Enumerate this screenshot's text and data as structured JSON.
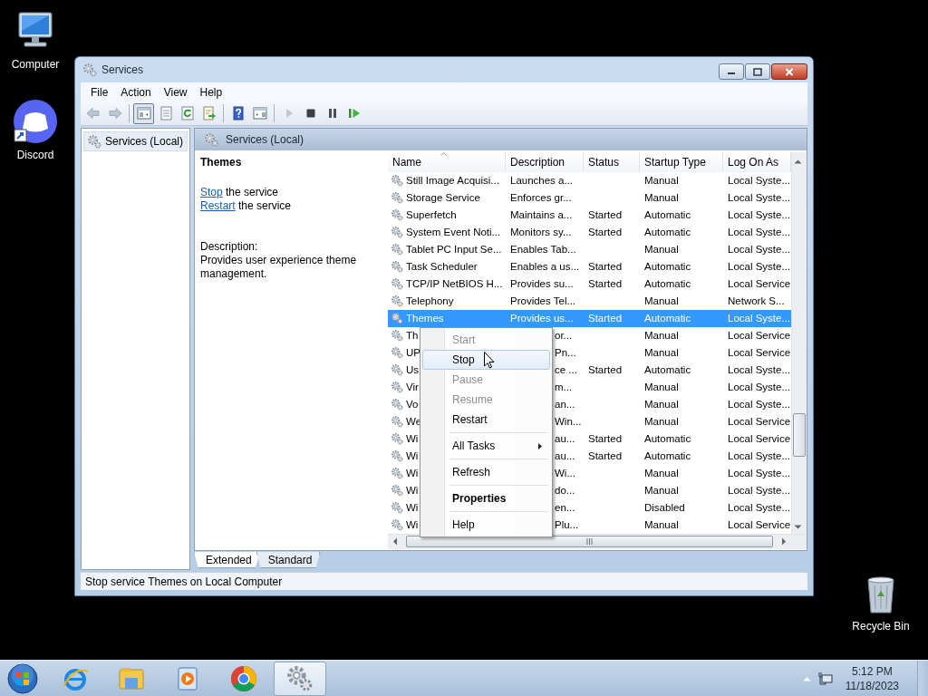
{
  "desktop_icons": [
    {
      "label": "Computer",
      "kind": "computer"
    },
    {
      "label": "Discord",
      "kind": "discord"
    },
    {
      "label": "Recycle Bin",
      "kind": "recycle"
    }
  ],
  "window": {
    "title": "Services",
    "menu": [
      "File",
      "Action",
      "View",
      "Help"
    ],
    "toolbar": [
      {
        "kind": "back",
        "disabled": true,
        "pressed": false
      },
      {
        "kind": "forward",
        "disabled": true,
        "pressed": false
      },
      {
        "kind": "separator"
      },
      {
        "kind": "console",
        "disabled": false,
        "pressed": true
      },
      {
        "kind": "properties",
        "disabled": false,
        "pressed": false
      },
      {
        "kind": "refresh",
        "disabled": false,
        "pressed": false
      },
      {
        "kind": "export",
        "disabled": false,
        "pressed": false
      },
      {
        "kind": "separator"
      },
      {
        "kind": "help",
        "disabled": false,
        "pressed": false
      },
      {
        "kind": "panel",
        "disabled": false,
        "pressed": false
      },
      {
        "kind": "separator"
      },
      {
        "kind": "start",
        "disabled": true,
        "pressed": false
      },
      {
        "kind": "stop",
        "disabled": false,
        "pressed": false
      },
      {
        "kind": "pause",
        "disabled": false,
        "pressed": false
      },
      {
        "kind": "resume",
        "disabled": false,
        "pressed": false
      }
    ],
    "tree": [
      {
        "label": "Services (Local)",
        "selected": true
      }
    ],
    "header": "Services (Local)",
    "details": {
      "title": "Themes",
      "actions": [
        {
          "link": "Stop",
          "text": " the service"
        },
        {
          "link": "Restart",
          "text": " the service"
        }
      ],
      "description_label": "Description:",
      "description": "Provides user experience theme management."
    },
    "table": {
      "columns": [
        {
          "label": "Name",
          "sorted": true
        },
        {
          "label": "Description",
          "sorted": false
        },
        {
          "label": "Status",
          "sorted": false
        },
        {
          "label": "Startup Type",
          "sorted": false
        },
        {
          "label": "Log On As",
          "sorted": false
        }
      ],
      "rows": [
        {
          "kind": "full",
          "name": "Still Image Acquisi...",
          "description": "Launches a...",
          "startup": "Manual",
          "logon": "Local Syste...",
          "selected": false
        },
        {
          "kind": "full",
          "name": "Storage Service",
          "description": "Enforces gr...",
          "startup": "Manual",
          "logon": "Local Syste...",
          "selected": false
        },
        {
          "kind": "full",
          "name": "Superfetch",
          "description": "Maintains a...",
          "status": "Started",
          "startup": "Automatic",
          "logon": "Local Syste...",
          "selected": false
        },
        {
          "kind": "full",
          "name": "System Event Noti...",
          "description": "Monitors sy...",
          "status": "Started",
          "startup": "Automatic",
          "logon": "Local Syste...",
          "selected": false
        },
        {
          "kind": "full",
          "name": "Tablet PC Input Se...",
          "description": "Enables Tab...",
          "startup": "Manual",
          "logon": "Local Syste...",
          "selected": false
        },
        {
          "kind": "full",
          "name": "Task Scheduler",
          "description": "Enables a us...",
          "status": "Started",
          "startup": "Automatic",
          "logon": "Local Syste...",
          "selected": false
        },
        {
          "kind": "full",
          "name": "TCP/IP NetBIOS H...",
          "description": "Provides su...",
          "status": "Started",
          "startup": "Automatic",
          "logon": "Local Service",
          "selected": false
        },
        {
          "kind": "full",
          "name": "Telephony",
          "description": "Provides Tel...",
          "startup": "Manual",
          "logon": "Network S...",
          "selected": false
        },
        {
          "kind": "full",
          "name": "Themes",
          "description": "Provides us...",
          "status": "Started",
          "startup": "Automatic",
          "logon": "Local Syste...",
          "selected": true
        },
        {
          "kind": "under_menu",
          "name": "Th",
          "description": "or...",
          "startup": "Manual",
          "logon": "Local Service",
          "selected": false
        },
        {
          "kind": "under_menu",
          "name": "UP",
          "description": "Pn...",
          "startup": "Manual",
          "logon": "Local Service",
          "selected": false
        },
        {
          "kind": "under_menu",
          "name": "Us",
          "description": "ce ...",
          "status": "Started",
          "startup": "Automatic",
          "logon": "Local Syste...",
          "selected": false
        },
        {
          "kind": "under_menu",
          "name": "Vir",
          "description": "m...",
          "startup": "Manual",
          "logon": "Local Syste...",
          "selected": false
        },
        {
          "kind": "under_menu",
          "name": "Vo",
          "description": "an...",
          "startup": "Manual",
          "logon": "Local Syste...",
          "selected": false
        },
        {
          "kind": "under_menu",
          "name": "We",
          "description": "Win...",
          "startup": "Manual",
          "logon": "Local Service",
          "selected": false
        },
        {
          "kind": "under_menu",
          "name": "Wi",
          "description": "au...",
          "status": "Started",
          "startup": "Automatic",
          "logon": "Local Service",
          "selected": false
        },
        {
          "kind": "under_menu",
          "name": "Wi",
          "description": "au...",
          "status": "Started",
          "startup": "Automatic",
          "logon": "Local Syste...",
          "selected": false
        },
        {
          "kind": "under_menu",
          "name": "Wi",
          "description": "Wi...",
          "startup": "Manual",
          "logon": "Local Syste...",
          "selected": false
        },
        {
          "kind": "under_menu",
          "name": "Wi",
          "description": "do...",
          "startup": "Manual",
          "logon": "Local Syste...",
          "selected": false
        },
        {
          "kind": "under_menu",
          "name": "Wi",
          "description": "en...",
          "startup": "Disabled",
          "logon": "Local Syste...",
          "selected": false
        },
        {
          "kind": "under_menu",
          "name": "Wi",
          "description": "Plu...",
          "startup": "Manual",
          "logon": "Local Service",
          "selected": false
        }
      ]
    },
    "context_menu": [
      {
        "kind": "item",
        "label": "Start",
        "disabled": true,
        "selected": false,
        "submenu": false,
        "default": false
      },
      {
        "kind": "item",
        "label": "Stop",
        "disabled": false,
        "selected": true,
        "submenu": false,
        "default": false
      },
      {
        "kind": "item",
        "label": "Pause",
        "disabled": true,
        "selected": false,
        "submenu": false,
        "default": false
      },
      {
        "kind": "item",
        "label": "Resume",
        "disabled": true,
        "selected": false,
        "submenu": false,
        "default": false
      },
      {
        "kind": "item",
        "label": "Restart",
        "disabled": false,
        "selected": false,
        "submenu": false,
        "default": false
      },
      {
        "kind": "separator"
      },
      {
        "kind": "item",
        "label": "All Tasks",
        "disabled": false,
        "selected": false,
        "submenu": true,
        "default": false
      },
      {
        "kind": "separator"
      },
      {
        "kind": "item",
        "label": "Refresh",
        "disabled": false,
        "selected": false,
        "submenu": false,
        "default": false
      },
      {
        "kind": "separator"
      },
      {
        "kind": "item",
        "label": "Properties",
        "disabled": false,
        "selected": false,
        "submenu": false,
        "default": true
      },
      {
        "kind": "separator"
      },
      {
        "kind": "item",
        "label": "Help",
        "disabled": false,
        "selected": false,
        "submenu": false,
        "default": false
      }
    ],
    "tabs": [
      {
        "label": "Extended",
        "selected": true
      },
      {
        "label": "Standard",
        "selected": false
      }
    ],
    "status_bar": "Stop service Themes on Local Computer"
  },
  "taskbar": {
    "apps": [
      {
        "kind": "ie",
        "active": false
      },
      {
        "kind": "explorer",
        "active": false
      },
      {
        "kind": "media",
        "active": false
      },
      {
        "kind": "chrome",
        "active": false
      },
      {
        "kind": "services",
        "active": true
      }
    ],
    "time": "5:12 PM",
    "date": "11/18/2023"
  }
}
